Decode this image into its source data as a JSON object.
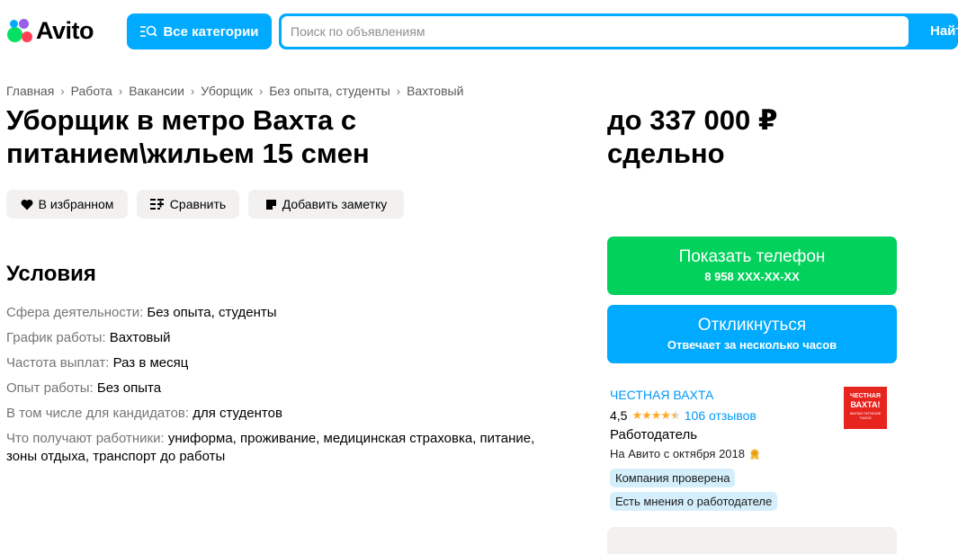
{
  "header": {
    "logo_text": "Avito",
    "categories_label": "Все категории",
    "search_placeholder": "Поиск по объявлениям",
    "find_label": "Найти"
  },
  "breadcrumbs": [
    "Главная",
    "Работа",
    "Вакансии",
    "Уборщик",
    "Без опыта, студенты",
    "Вахтовый"
  ],
  "listing": {
    "title": "Уборщик в метро Вахта с питанием\\жильем 15 смен",
    "price_line1": "до 337 000 ₽",
    "price_line2": "сдельно"
  },
  "actions": {
    "favorite_label": "В избранном",
    "compare_label": "Сравнить",
    "note_label": "Добавить заметку"
  },
  "conditions": {
    "title": "Условия",
    "rows": [
      {
        "key": "Сфера деятельности:",
        "value": "Без опыта, студенты"
      },
      {
        "key": "График работы:",
        "value": "Вахтовый"
      },
      {
        "key": "Частота выплат:",
        "value": "Раз в месяц"
      },
      {
        "key": "Опыт работы:",
        "value": "Без опыта"
      },
      {
        "key": "В том числе для кандидатов:",
        "value": "для студентов"
      },
      {
        "key": "Что получают работники:",
        "value": "униформа, проживание, медицинская страховка, питание, зоны отдыха, транспорт до работы"
      }
    ]
  },
  "contact": {
    "phone_title": "Показать телефон",
    "phone_number": "8 958 XXX-XX-XX",
    "reply_title": "Откликнуться",
    "reply_sub": "Отвечает за несколько часов"
  },
  "seller": {
    "name": "ЧЕСТНАЯ ВАХТА",
    "rating": "4,5",
    "rating_value": 4.5,
    "reviews": "106 отзывов",
    "type": "Работодатель",
    "since": "На Авито с октября 2018",
    "badge_verified": "Компания проверена",
    "badge_opinions": "Есть мнения о работодателе",
    "logo_line1": "ЧЕСТНАЯ",
    "logo_line2": "ВАХТА!",
    "logo_line3": "ЖИЛЬЕ ПИТАНИЕ ТАКСИ"
  },
  "colors": {
    "accent_blue": "#00aaff",
    "green": "#02d15c",
    "link_blue": "#0099f7",
    "star": "#ffa928",
    "badge_bg": "#d4effb",
    "logo_red": "#e8241e"
  }
}
